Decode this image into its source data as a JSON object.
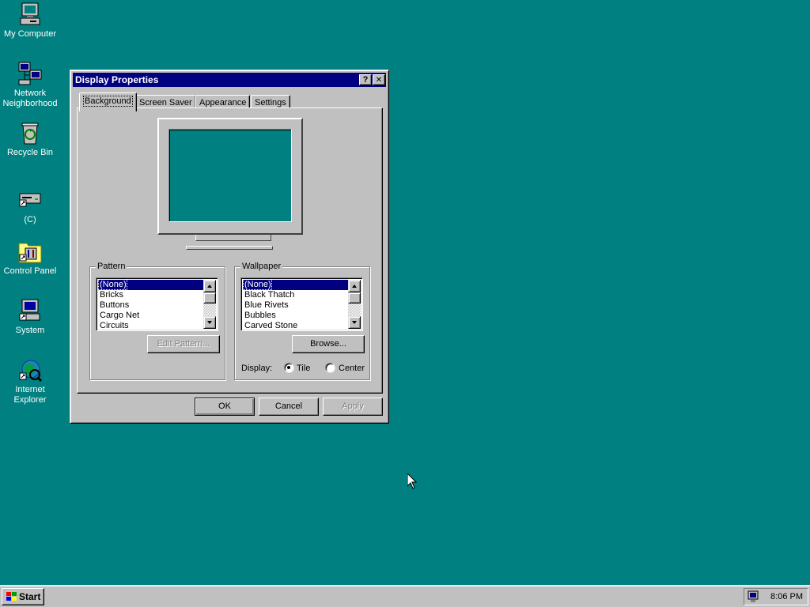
{
  "desktop": {
    "background_color": "#008080",
    "icons": [
      {
        "label": "My Computer",
        "icon": "my-computer-icon"
      },
      {
        "label_line1": "Network",
        "label_line2": "Neighborhood",
        "icon": "network-neighborhood-icon"
      },
      {
        "label": "Recycle Bin",
        "icon": "recycle-bin-icon"
      },
      {
        "label": "(C)",
        "icon": "drive-shortcut-icon"
      },
      {
        "label": "Control Panel",
        "icon": "control-panel-icon"
      },
      {
        "label": "System",
        "icon": "system-icon"
      },
      {
        "label_line1": "Internet",
        "label_line2": "Explorer",
        "icon": "internet-explorer-icon"
      }
    ]
  },
  "dialog": {
    "title": "Display Properties",
    "help_button": "?",
    "close_button": "✕",
    "tabs": [
      {
        "label": "Background",
        "active": true
      },
      {
        "label": "Screen Saver",
        "active": false
      },
      {
        "label": "Appearance",
        "active": false
      },
      {
        "label": "Settings",
        "active": false
      }
    ],
    "pattern": {
      "legend": "Pattern",
      "items": [
        "(None)",
        "Bricks",
        "Buttons",
        "Cargo Net",
        "Circuits"
      ],
      "selected": "(None)",
      "edit_button": "Edit Pattern..."
    },
    "wallpaper": {
      "legend": "Wallpaper",
      "items": [
        "(None)",
        "Black Thatch",
        "Blue Rivets",
        "Bubbles",
        "Carved Stone"
      ],
      "selected": "(None)",
      "browse_button": "Browse...",
      "display_label": "Display:",
      "options": [
        {
          "label": "Tile",
          "checked": true
        },
        {
          "label": "Center",
          "checked": false
        }
      ]
    },
    "buttons": {
      "ok": "OK",
      "cancel": "Cancel",
      "apply": "Apply"
    }
  },
  "taskbar": {
    "start_label": "Start",
    "clock": "8:06 PM"
  },
  "colors": {
    "title_bar": "#000080",
    "face": "#c0c0c0",
    "selection": "#000080"
  }
}
